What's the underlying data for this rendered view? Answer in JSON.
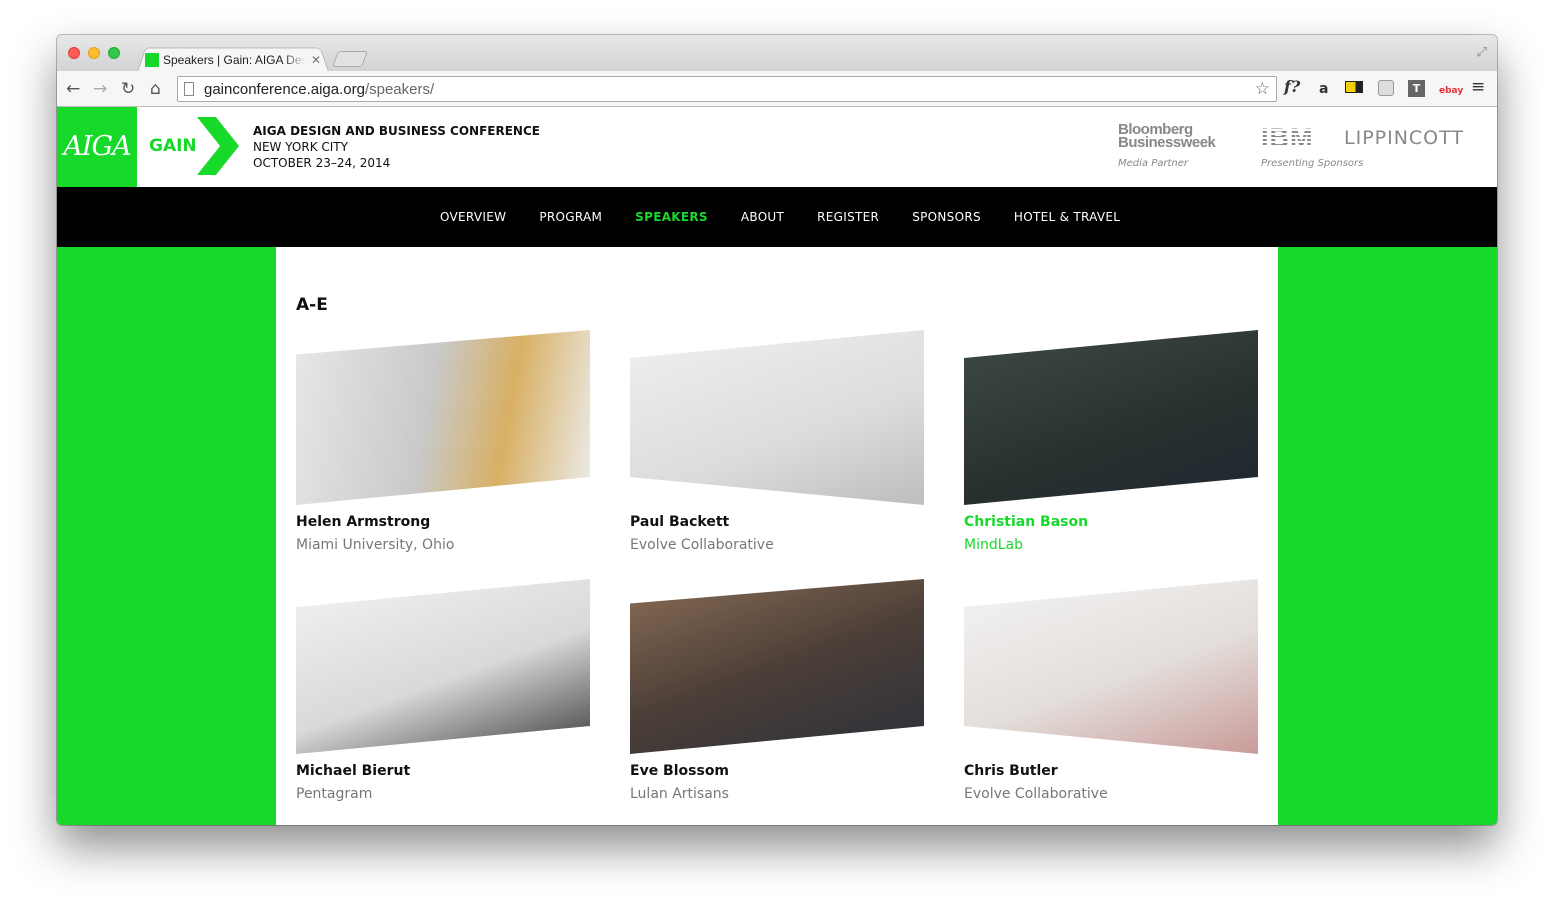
{
  "browser": {
    "tab_title": "Speakers | Gain: AIGA Design and Business Conference",
    "tab_close": "✕",
    "url_host": "gainconference.aiga.org",
    "url_path": "/speakers/",
    "icons": [
      "back-icon",
      "forward-icon",
      "reload-icon",
      "home-icon",
      "page-icon",
      "star-icon",
      "menu-icon"
    ]
  },
  "header": {
    "aiga_logo": "AIGA",
    "gain_logo": "GAIN",
    "conference_title": "AIGA DESIGN AND BUSINESS CONFERENCE",
    "city": "NEW YORK CITY",
    "dates": "OCTOBER 23–24, 2014",
    "media_partner_line1": "Bloomberg",
    "media_partner_line2": "Businessweek",
    "media_partner_caption": "Media Partner",
    "sponsor_ibm": "IBM",
    "sponsor_lippincott": "LIPPINCOTT",
    "sponsors_caption": "Presenting Sponsors"
  },
  "nav": {
    "items": [
      {
        "label": "OVERVIEW"
      },
      {
        "label": "PROGRAM"
      },
      {
        "label": "SPEAKERS"
      },
      {
        "label": "ABOUT"
      },
      {
        "label": "REGISTER"
      },
      {
        "label": "SPONSORS"
      },
      {
        "label": "HOTEL & TRAVEL"
      }
    ],
    "active": "SPEAKERS"
  },
  "main": {
    "section_title": "A-E",
    "speakers": [
      {
        "name": "Helen Armstrong",
        "org": "Miami University, Ohio"
      },
      {
        "name": "Paul Backett",
        "org": "Evolve Collaborative"
      },
      {
        "name": "Christian Bason",
        "org": "MindLab"
      },
      {
        "name": "Michael Bierut",
        "org": "Pentagram"
      },
      {
        "name": "Eve Blossom",
        "org": "Lulan Artisans"
      },
      {
        "name": "Chris Butler",
        "org": "Evolve Collaborative"
      }
    ]
  },
  "colors": {
    "brand_green": "#16d92a",
    "nav_background": "#000000"
  }
}
